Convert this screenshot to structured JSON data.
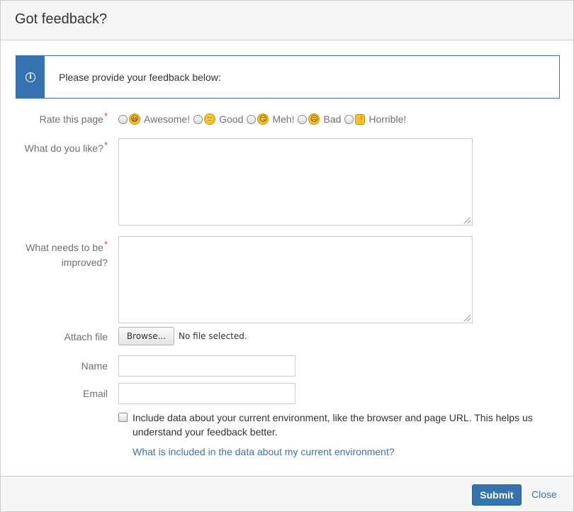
{
  "dialog": {
    "title": "Got feedback?"
  },
  "info": {
    "icon": "info-icon",
    "message": "Please provide your feedback below:",
    "accent_color": "#3572b0"
  },
  "form": {
    "required_marker": "*",
    "rating": {
      "label": "Rate this page",
      "options": [
        {
          "label": "Awesome!",
          "icon": "grinning-face-icon",
          "glyph": "😃"
        },
        {
          "label": "Good",
          "icon": "smiling-face-icon",
          "glyph": "🙂"
        },
        {
          "label": "Meh!",
          "icon": "smirking-face-icon",
          "glyph": "😏"
        },
        {
          "label": "Bad",
          "icon": "frowning-face-icon",
          "glyph": "☹"
        },
        {
          "label": "Horrible!",
          "icon": "thumbs-down-icon",
          "glyph": "👎"
        }
      ]
    },
    "like": {
      "label": "What do you like?",
      "value": ""
    },
    "improve": {
      "label_line1": "What needs to be",
      "label_line2": "improved?",
      "value": ""
    },
    "attach": {
      "label": "Attach file",
      "button_label": "Browse...",
      "status": "No file selected."
    },
    "name": {
      "label": "Name",
      "value": ""
    },
    "email": {
      "label": "Email",
      "value": ""
    },
    "include_env": {
      "checked": false,
      "label": "Include data about your current environment, like the browser and page URL. This helps us understand your feedback better.",
      "link_text": "What is included in the data about my current environment?"
    }
  },
  "footer": {
    "submit_label": "Submit",
    "close_label": "Close"
  }
}
